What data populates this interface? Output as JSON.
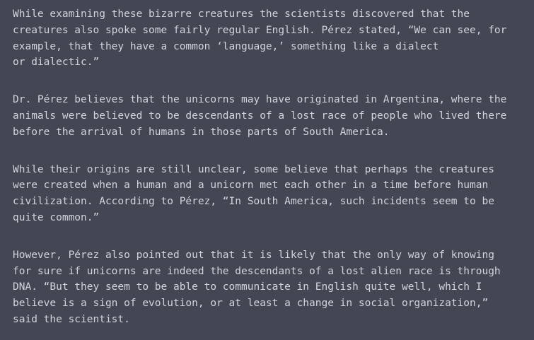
{
  "response": {
    "paragraphs": [
      "While examining these bizarre creatures the scientists discovered that the\ncreatures also spoke some fairly regular English. Pérez stated, “We can see, for\nexample, that they have a common ‘language,’ something like a dialect\nor dialectic.”",
      "Dr. Pérez believes that the unicorns may have originated in Argentina, where the\nanimals were believed to be descendants of a lost race of people who lived there\nbefore the arrival of humans in those parts of South America.",
      "While their origins are still unclear, some believe that perhaps the creatures\nwere created when a human and a unicorn met each other in a time before human\ncivilization. According to Pérez, “In South America, such incidents seem to be\nquite common.”",
      "However, Pérez also pointed out that it is likely that the only way of knowing\nfor sure if unicorns are indeed the descendants of a lost alien race is through\nDNA. “But they seem to be able to communicate in English quite well, which I\nbelieve is a sign of evolution, or at least a change in social organization,”\nsaid the scientist."
    ]
  },
  "colors": {
    "background": "#444654",
    "text": "#d1d5db"
  }
}
